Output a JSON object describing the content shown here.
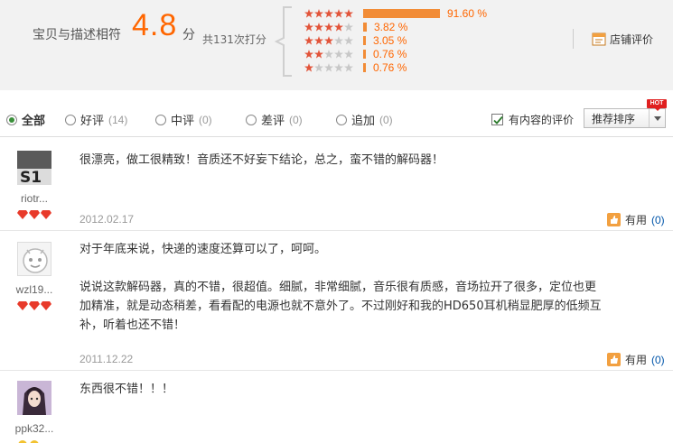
{
  "summary": {
    "label": "宝贝与描述相符",
    "score": "4.8",
    "unit": "分",
    "total": "共131次打分",
    "distribution": [
      {
        "stars": 5,
        "percent_text": "91.60 %",
        "percent": 91.6
      },
      {
        "stars": 4,
        "percent_text": "3.82 %",
        "percent": 3.82
      },
      {
        "stars": 3,
        "percent_text": "3.05 %",
        "percent": 3.05
      },
      {
        "stars": 2,
        "percent_text": "0.76 %",
        "percent": 0.76
      },
      {
        "stars": 1,
        "percent_text": "0.76 %",
        "percent": 0.76
      }
    ],
    "shop_rating_label": "店铺评价"
  },
  "filters": {
    "items": [
      {
        "label": "全部",
        "count": "",
        "checked": true
      },
      {
        "label": "好评",
        "count": "(14)",
        "checked": false
      },
      {
        "label": "中评",
        "count": "(0)",
        "checked": false
      },
      {
        "label": "差评",
        "count": "(0)",
        "checked": false
      },
      {
        "label": "追加",
        "count": "(0)",
        "checked": false
      }
    ],
    "has_content_label": "有内容的评价",
    "has_content_checked": true,
    "sort_selected": "推荐排序",
    "hot_badge": "HOT"
  },
  "reviews": [
    {
      "username": "riotr...",
      "paragraphs": [
        "很漂亮，做工很精致！音质还不好妄下结论，总之，蛮不错的解码器！"
      ],
      "date": "2012.02.17",
      "useful_label": "有用",
      "useful_count": "(0)",
      "avatar_icon": "avatar-s1-icon",
      "avatar_text": "S1"
    },
    {
      "username": "wzl19...",
      "paragraphs": [
        "对于年底来说，快递的速度还算可以了，呵呵。",
        "说说这款解码器，真的不错，很超值。细腻，非常细腻，音乐很有质感，音场拉开了很多，定位也更加精准，就是动态稍差，看看配的电源也就不意外了。不过刚好和我的HD650耳机稍显肥厚的低频互补，听着也还不错！"
      ],
      "date": "2011.12.22",
      "useful_label": "有用",
      "useful_count": "(0)",
      "avatar_icon": "default-avatar-icon"
    },
    {
      "username": "ppk32...",
      "paragraphs": [
        "东西很不错！！！"
      ],
      "avatar_icon": "anime-avatar-icon"
    }
  ],
  "colors": {
    "accent": "#ff6600",
    "bar": "#f28c36",
    "star": "#e2543a",
    "link": "#0055aa",
    "summary_bg": "#f2f2f2"
  }
}
